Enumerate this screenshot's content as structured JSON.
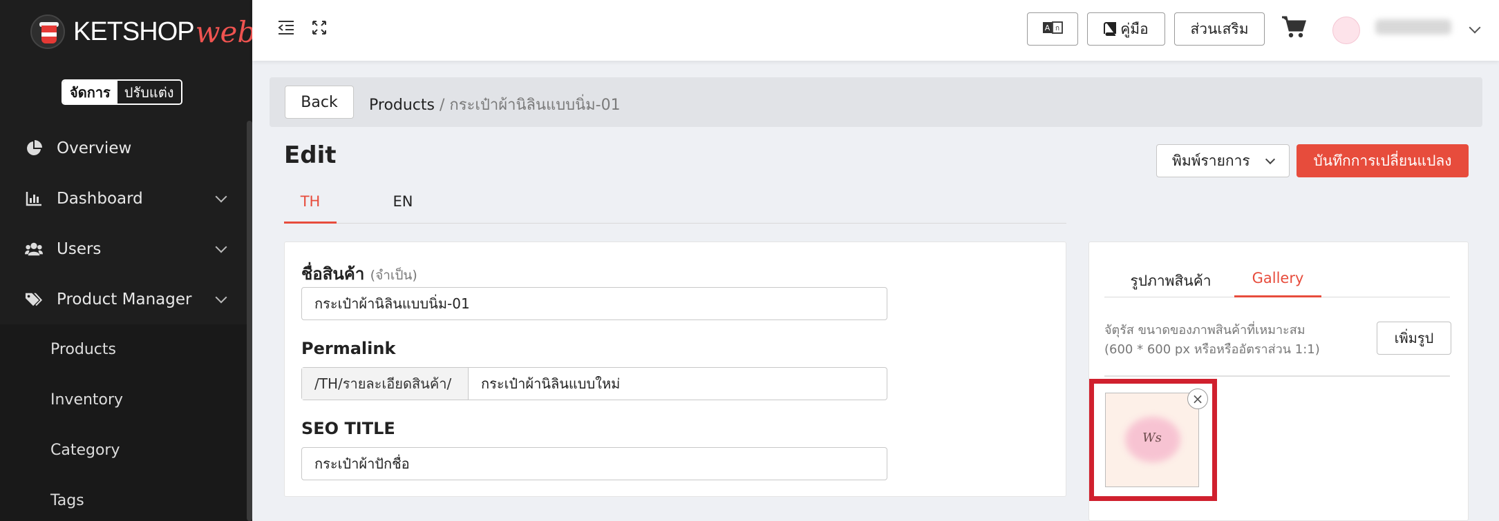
{
  "brand": {
    "name": "KETSHOP",
    "suffix": "web"
  },
  "mode_switch": {
    "active": "จัดการ",
    "inactive": "ปรับแต่ง"
  },
  "sidebar": {
    "items": [
      {
        "label": "Overview",
        "icon": "pie-chart-icon",
        "expandable": false
      },
      {
        "label": "Dashboard",
        "icon": "bar-chart-icon",
        "expandable": true
      },
      {
        "label": "Users",
        "icon": "users-icon",
        "expandable": true
      },
      {
        "label": "Product Manager",
        "icon": "tags-icon",
        "expandable": true
      }
    ],
    "sub_items": [
      "Products",
      "Inventory",
      "Category",
      "Tags"
    ]
  },
  "topbar": {
    "translate_icon": "translate-icon",
    "manual_label": "คู่มือ",
    "addons_label": "ส่วนเสริม",
    "cart_icon": "cart-icon"
  },
  "breadcrumb": {
    "back_label": "Back",
    "parent": "Products",
    "separator": "/",
    "current": "กระเป๋าผ้านิลินแบบนิ่ม-01"
  },
  "page": {
    "title": "Edit",
    "print_label": "พิมพ์รายการ",
    "save_label": "บันทึกการเปลี่ยนแปลง"
  },
  "lang_tabs": [
    "TH",
    "EN"
  ],
  "form": {
    "name_label": "ชื่อสินค้า",
    "name_required": "(จำเป็น)",
    "name_value": "กระเป๋าผ้านิลินแบบนิ่ม-01",
    "permalink_label": "Permalink",
    "permalink_prefix": "/TH/รายละเอียดสินค้า/",
    "permalink_value": "กระเป๋าผ้านิลินแบบใหม่",
    "seo_title_label": "SEO TITLE",
    "seo_title_value": "กระเป๋าผ้าปักชื่อ"
  },
  "image_panel": {
    "tabs": [
      "รูปภาพสินค้า",
      "Gallery"
    ],
    "active_tab": "Gallery",
    "hint_line1": "จัตุรัส ขนาดของภาพสินค้าที่เหมาะสม",
    "hint_line2": "(600 * 600 px หรือหรืออัตราส่วน 1:1)",
    "add_label": "เพิ่มรูป",
    "thumb_mark": "Ws",
    "remove_symbol": "×"
  },
  "colors": {
    "accent": "#e74c3c",
    "sidebar_bg": "#1e1e1e",
    "highlight": "#d0202e"
  }
}
